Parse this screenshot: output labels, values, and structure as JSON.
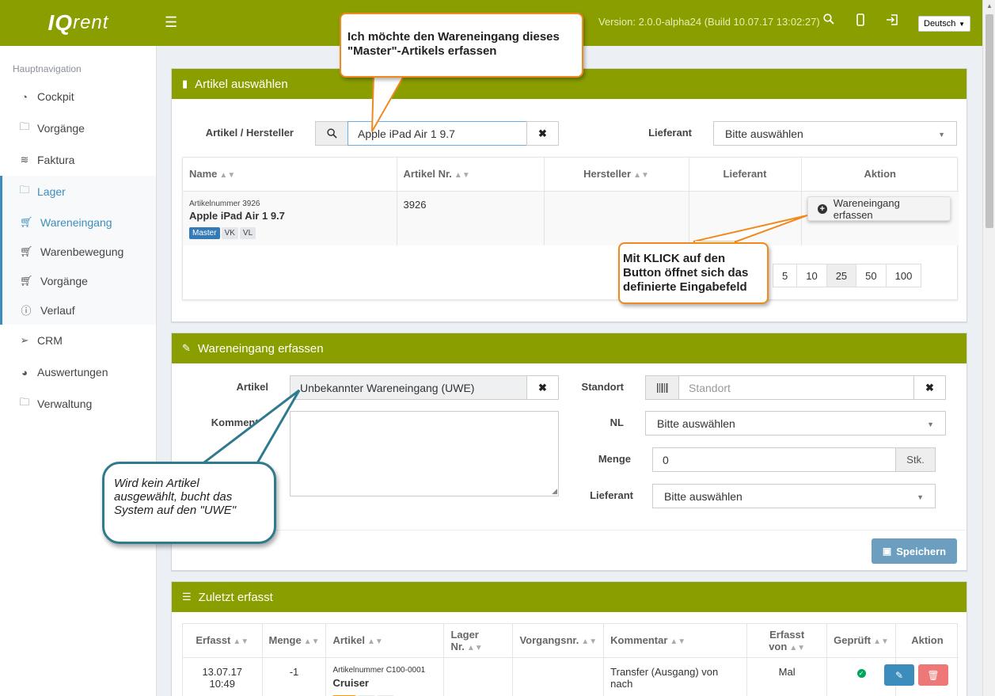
{
  "app": {
    "logo_iq": "IQ",
    "logo_rent": "rent",
    "version": "Version: 2.0.0-alpha24 (Build 10.07.17 13:02:27)",
    "language": "Deutsch"
  },
  "sidebar": {
    "header": "Hauptnavigation",
    "items": [
      {
        "label": "Cockpit",
        "icon": "dashboard-icon"
      },
      {
        "label": "Vorgänge",
        "icon": "folder-icon"
      },
      {
        "label": "Faktura",
        "icon": "layers-icon"
      },
      {
        "label": "Lager",
        "icon": "folder-icon"
      },
      {
        "label": "Wareneingang",
        "icon": "cart-icon"
      },
      {
        "label": "Warenbewegung",
        "icon": "cart-icon"
      },
      {
        "label": "Vorgänge",
        "icon": "cart-icon"
      },
      {
        "label": "Verlauf",
        "icon": "info-icon"
      },
      {
        "label": "CRM",
        "icon": "paper-plane-icon"
      },
      {
        "label": "Auswertungen",
        "icon": "pie-chart-icon"
      },
      {
        "label": "Verwaltung",
        "icon": "folder-icon"
      }
    ]
  },
  "select_article": {
    "title": "Artikel auswählen",
    "article_label": "Artikel / Hersteller",
    "search_value": "Apple iPad Air 1 9.7",
    "supplier_label": "Lieferant",
    "supplier_value": "Bitte auswählen",
    "columns": [
      "Name",
      "Artikel Nr.",
      "Hersteller",
      "Lieferant",
      "Aktion"
    ],
    "row": {
      "article_number_caption": "Artikelnummer 3926",
      "name": "Apple iPad Air 1 9.7",
      "tags": [
        "Master",
        "VK",
        "VL"
      ],
      "article_nr": "3926",
      "action_label": "Wareneingang erfassen"
    },
    "page_sizes": [
      "5",
      "10",
      "25",
      "50",
      "100"
    ],
    "active_page_size": "25"
  },
  "goods_receipt": {
    "title": "Wareneingang erfassen",
    "article_label": "Artikel",
    "article_value": "Unbekannter Wareneingang (UWE)",
    "comment_label": "Kommentar",
    "location_label": "Standort",
    "location_placeholder": "Standort",
    "nl_label": "NL",
    "nl_value": "Bitte auswählen",
    "quantity_label": "Menge",
    "quantity_value": "0",
    "quantity_unit": "Stk.",
    "supplier_label": "Lieferant",
    "supplier_value": "Bitte auswählen",
    "save_label": "Speichern"
  },
  "recent": {
    "title": "Zuletzt erfasst",
    "columns": [
      "Erfasst",
      "Menge",
      "Artikel",
      "Lager Nr.",
      "Vorgangsnr.",
      "Kommentar",
      "Erfasst von",
      "Geprüft",
      "Aktion"
    ],
    "rows": [
      {
        "date": "13.07.17 10:49",
        "quantity": "-1",
        "article_caption": "Artikelnummer C100-0001",
        "article_name": "Cruiser",
        "comment": "Transfer (Ausgang) von nach",
        "by": "Mal"
      }
    ]
  },
  "callouts": {
    "top": "Ich möchte den Wareneingang dieses \"Master\"-Artikels erfassen",
    "button": "Mit KLICK auf den Button öffnet sich das definierte Eingabefeld",
    "uwe": "Wird kein Artikel ausgewählt, bucht das System auf den \"UWE\""
  },
  "colors": {
    "brand_green": "#8a9e00",
    "link_blue": "#3c8dbc",
    "callout_orange": "#f08a1e",
    "callout_teal": "#2f7a8c"
  }
}
